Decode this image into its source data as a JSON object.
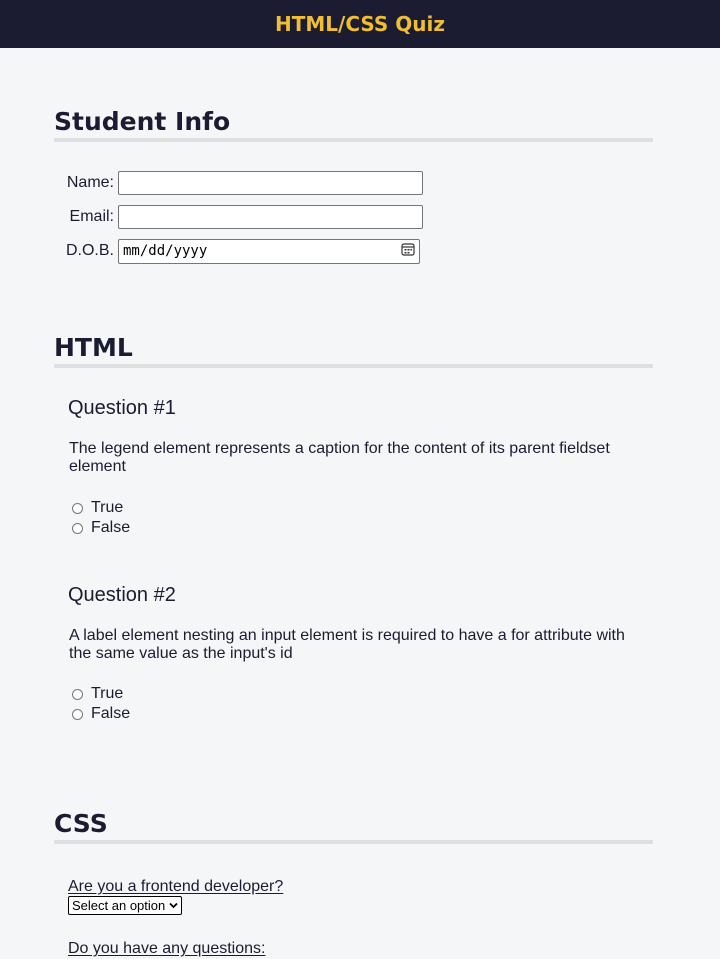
{
  "header": {
    "title": "HTML/CSS Quiz"
  },
  "student_info": {
    "heading": "Student Info",
    "fields": [
      {
        "label": "Name:",
        "value": ""
      },
      {
        "label": "Email:",
        "value": ""
      },
      {
        "label": "D.O.B.",
        "placeholder": "mm/dd/yyyy",
        "icon": "calendar-icon"
      }
    ]
  },
  "html_section": {
    "heading": "HTML",
    "questions": [
      {
        "title": "Question #1",
        "text": "The legend element represents a caption for the content of its parent fieldset element",
        "options": [
          "True",
          "False"
        ]
      },
      {
        "title": "Question #2",
        "text": "A label element nesting an input element is required to have a for attribute with the same value as the input's id",
        "options": [
          "True",
          "False"
        ]
      }
    ]
  },
  "css_section": {
    "heading": "CSS",
    "frontend_question": "Are you a frontend developer?",
    "select_value": "Select an option",
    "questions_prompt": "Do you have any questions:"
  }
}
